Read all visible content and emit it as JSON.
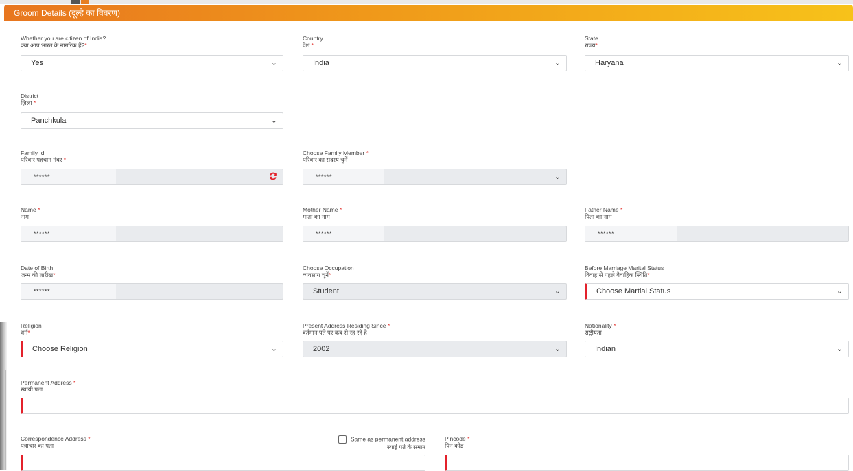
{
  "section": {
    "title": "Groom Details (दूल्हे का विवरण)"
  },
  "citizen": {
    "label_en": "Whether you are citizen of India?",
    "label_hi": "क्या आप भारत के नागरिक हैं?",
    "value": "Yes"
  },
  "country": {
    "label_en": "Country",
    "label_hi": "देश",
    "value": "India"
  },
  "state": {
    "label_en": "State",
    "label_hi": "राज्य",
    "value": "Haryana"
  },
  "district": {
    "label_en": "District",
    "label_hi": "ज़िला",
    "value": "Panchkula"
  },
  "family_id": {
    "label_en": "Family Id",
    "label_hi": "परिवार पहचान नंबर",
    "value": "******"
  },
  "family_member": {
    "label_en": "Choose Family Member",
    "label_hi": "परिवार का सदस्य चुनें",
    "value": "******"
  },
  "name": {
    "label_en": "Name",
    "label_hi": "नाम",
    "value": "******"
  },
  "mother_name": {
    "label_en": "Mother Name",
    "label_hi": "माता का नाम",
    "value": "******"
  },
  "father_name": {
    "label_en": "Father Name",
    "label_hi": "पिता का नाम",
    "value": "******"
  },
  "dob": {
    "label_en": "Date of Birth",
    "label_hi": "जन्म की तारीख",
    "value": "******"
  },
  "occupation": {
    "label_en": "Choose Occupation",
    "label_hi": "व्यवसाय चुनें",
    "value": "Student"
  },
  "marital_status": {
    "label_en": "Before Marriage Marital Status",
    "label_hi": "विवाह से पहले वैवाहिक स्थिति",
    "value": "Choose Martial Status"
  },
  "religion": {
    "label_en": "Religion",
    "label_hi": "धर्म",
    "value": "Choose Religion"
  },
  "residing_since": {
    "label_en": "Present Address Residing Since",
    "label_hi": "वर्तमान पते पर कब से रह रहे है",
    "value": "2002"
  },
  "nationality": {
    "label_en": "Nationality",
    "label_hi": "राष्ट्रीयता",
    "value": "Indian"
  },
  "permanent_address": {
    "label_en": "Permanent Address",
    "label_hi": "स्थायी पता",
    "value": ""
  },
  "correspondence_address": {
    "label_en": "Correspondence Address",
    "label_hi": "पत्राचार का पता",
    "value": ""
  },
  "same_as_permanent": {
    "label_en": "Same as permanent address",
    "label_hi": "स्थाई पते के समान",
    "checked": false
  },
  "pincode": {
    "label_en": "Pincode",
    "label_hi": "पिन कोड",
    "value": ""
  },
  "required_mark": "*",
  "icons": {
    "dropdown": "chevron-down-icon",
    "refresh": "refresh-icon"
  },
  "colors": {
    "header_start": "#e8761f",
    "header_end": "#f7c21a",
    "required": "#e3342f",
    "invalid_border": "#e3212b",
    "readonly_bg": "#e9ebee"
  }
}
